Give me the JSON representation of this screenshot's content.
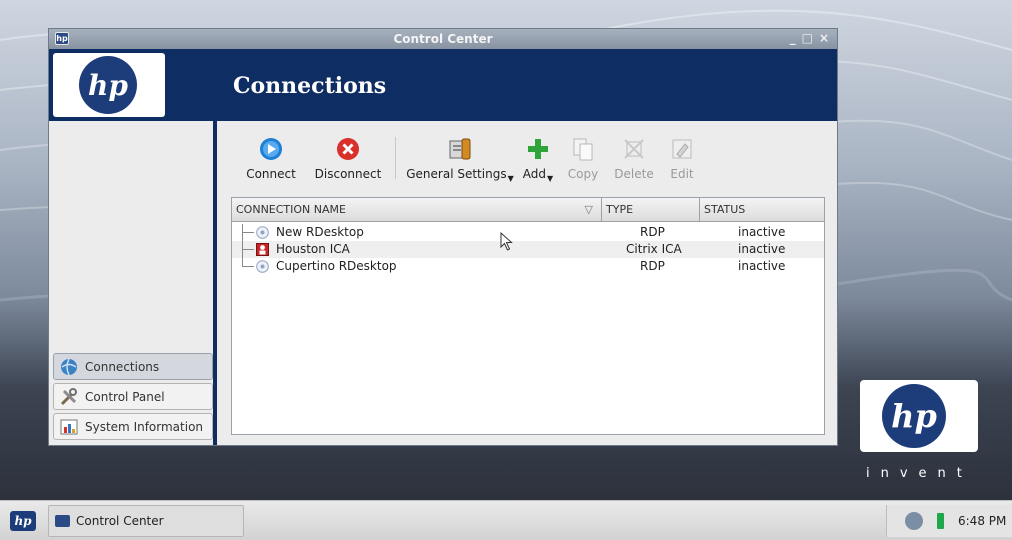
{
  "window": {
    "title": "Control Center",
    "controls": [
      "_",
      "□",
      "×"
    ],
    "header_title": "Connections",
    "logo_text": "hp"
  },
  "toolbar": {
    "connect": "Connect",
    "disconnect": "Disconnect",
    "general_settings": "General Settings",
    "add": "Add",
    "copy": "Copy",
    "delete": "Delete",
    "edit": "Edit"
  },
  "table": {
    "headers": {
      "name": "CONNECTION NAME",
      "type": "TYPE",
      "status": "STATUS"
    },
    "rows": [
      {
        "name": "New RDesktop",
        "type": "RDP",
        "status": "inactive",
        "icon": "rdp-icon"
      },
      {
        "name": "Houston ICA",
        "type": "Citrix ICA",
        "status": "inactive",
        "icon": "citrix-icon"
      },
      {
        "name": "Cupertino RDesktop",
        "type": "RDP",
        "status": "inactive",
        "icon": "rdp-icon"
      }
    ]
  },
  "sidebar": {
    "items": [
      {
        "label": "Connections",
        "icon": "globe-icon",
        "active": true
      },
      {
        "label": "Control Panel",
        "icon": "tools-icon",
        "active": false
      },
      {
        "label": "System Information",
        "icon": "chart-icon",
        "active": false
      }
    ]
  },
  "desktop": {
    "logo_text": "hp",
    "tagline": "invent"
  },
  "taskbar": {
    "start_logo": "hp",
    "task_label": "Control Center",
    "clock": "6:48 PM"
  },
  "colors": {
    "header_blue": "#0e2d63",
    "hp_blue": "#1d3c7a",
    "connect_blue": "#1e7fd6",
    "disconnect_red": "#d9302c",
    "add_green": "#2fa43a"
  }
}
